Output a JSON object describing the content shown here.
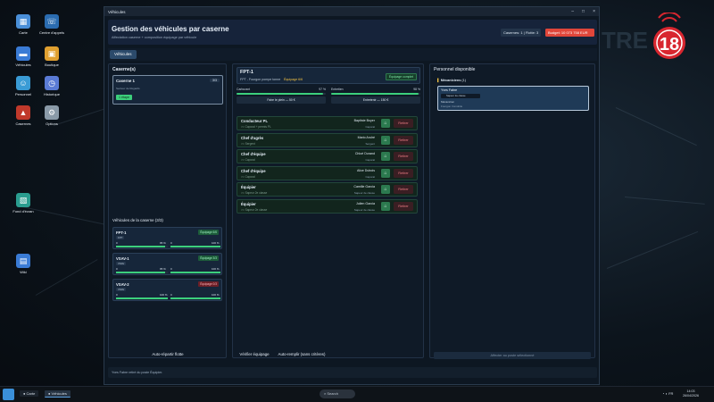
{
  "desktop": {
    "icons": [
      {
        "label": "Carte",
        "icon": "map-icon",
        "color": "#4a8fd8"
      },
      {
        "label": "Centre d'appels",
        "icon": "phone-icon",
        "color": "#2b6cb0"
      },
      {
        "label": "Véhicules",
        "icon": "truck-icon",
        "color": "#3a7bd5"
      },
      {
        "label": "Boutique",
        "icon": "shop-icon",
        "color": "#e0a030"
      },
      {
        "label": "Personnel",
        "icon": "people-icon",
        "color": "#3a9bd5"
      },
      {
        "label": "Historique",
        "icon": "history-icon",
        "color": "#5a7bd5"
      },
      {
        "label": "Casernes",
        "icon": "station-icon",
        "color": "#c0392b"
      },
      {
        "label": "Options",
        "icon": "gear-icon",
        "color": "#8a9aa8"
      },
      {
        "label": "Fond d'écran",
        "icon": "wallpaper-icon",
        "color": "#2a9d8f"
      },
      {
        "label": "Wiki",
        "icon": "book-icon",
        "color": "#3a7bd5"
      }
    ],
    "brand_text": "18"
  },
  "window": {
    "title": "Véhicules",
    "header": {
      "title": "Gestion des véhicules par caserne",
      "subtitle": "Affectation caserne + composition équipage par véhicule",
      "casernes_pill": "Casernes: 1 | Flotte: 3",
      "budget_pill": "Budget: 10 073 758 EUR",
      "casernes_color": "#23344a",
      "budget_color": "#e0463a"
    },
    "tab": "Véhicules",
    "left": {
      "title": "Caserne(s)",
      "caserne": {
        "name": "Caserne 1",
        "count": "3/3",
        "sub": "Secteur de Regards",
        "badge": "1 étape"
      },
      "vehicles_title": "Véhicules de la caserne (3/3)",
      "vehicles": [
        {
          "name": "FPT-1",
          "tag": "FPT",
          "status": "Équipage 6/6",
          "status_kind": "ok",
          "fuel": "0",
          "fuel_pct": "95 %",
          "wear_left": "0",
          "wear_pct": "100 %",
          "fuel_val": 0.95,
          "wear_val": 1.0
        },
        {
          "name": "VSAV-1",
          "tag": "VSAV",
          "status": "Équipage 3/3",
          "status_kind": "ok",
          "fuel": "0",
          "fuel_pct": "95 %",
          "wear_left": "0",
          "wear_pct": "100 %",
          "fuel_val": 0.95,
          "wear_val": 1.0
        },
        {
          "name": "VSAV-2",
          "tag": "VSAV",
          "status": "Équipage 0/3",
          "status_kind": "bad",
          "fuel": "0",
          "fuel_pct": "100 %",
          "wear_left": "0",
          "wear_pct": "100 %",
          "fuel_val": 1.0,
          "wear_val": 1.0
        }
      ],
      "auto_button": "Auto-répartir flotte"
    },
    "center": {
      "vehicle_name": "FPT-1",
      "vehicle_sub": "FPT - Fourgon pompe tonne",
      "crew_label": "Équipage 6/6",
      "complete_badge": "Équipage complet",
      "fuel_label": "Carburant",
      "fuel_pct": "97 %",
      "fuel_val": 0.97,
      "fuel_btn": "Faire le plein — 50 €",
      "maint_label": "Entretien",
      "maint_pct": "98 %",
      "maint_val": 0.98,
      "maint_btn": "Entretenir — 150 €",
      "slots": [
        {
          "role": "Conducteur PL",
          "req": ">= Caporal + permis PL",
          "name": "Baptiste Boyer",
          "rank": "Caporal"
        },
        {
          "role": "Chef d'agrès",
          "req": ">= Sergent",
          "name": "Mario André",
          "rank": "Sergent"
        },
        {
          "role": "Chef d'équipe",
          "req": ">= Caporal",
          "name": "Chloé Durand",
          "rank": "Caporal"
        },
        {
          "role": "Chef d'équipe",
          "req": ">= Caporal",
          "name": "Alice Dubois",
          "rank": "Caporal"
        },
        {
          "role": "Équipier",
          "req": ">= Sapeur 2e classe",
          "name": "Camille Garcia",
          "rank": "Sapeur 2e classe"
        },
        {
          "role": "Équipier",
          "req": ">= Sapeur 2e classe",
          "name": "Julien Garcia",
          "rank": "Sapeur 2e classe"
        }
      ],
      "lock_icon": "lock-icon",
      "remove_label": "Retirer",
      "verify_button": "Vérifier équipage",
      "autofill_button": "Auto-remplir (sans critères)"
    },
    "right": {
      "title": "Personnel disponible",
      "group": "Mécaniciens",
      "group_count": "(1)",
      "person": {
        "name": "Yves Fabre",
        "rank": "Sapeur 2e classe",
        "role": "Mécanicien",
        "status": "Fourgon Immobile"
      },
      "assign_button": "Affecter au poste sélectionné"
    },
    "status_bar": "Yves Fabre retiré du poste Équipier."
  },
  "taskbar": {
    "apps": [
      {
        "label": "Carte"
      },
      {
        "label": "Véhicules"
      }
    ],
    "search_placeholder": "Search",
    "time": "14:03",
    "date": "26/04/2026",
    "lang": "FR"
  }
}
